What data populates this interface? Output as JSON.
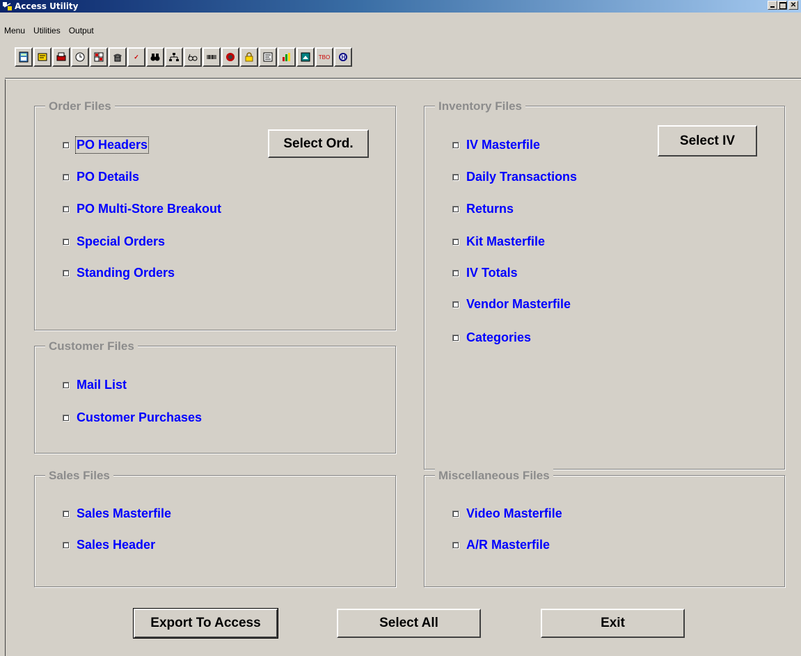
{
  "window": {
    "title": "Access Utility"
  },
  "menu": [
    {
      "label": "Menu"
    },
    {
      "label": "Utilities"
    },
    {
      "label": "Output"
    }
  ],
  "toolbar": {
    "icons": [
      "calculator",
      "note",
      "printer",
      "clock",
      "grid",
      "phone",
      "spell-check",
      "binoculars",
      "tree",
      "glasses",
      "barcode",
      "target",
      "lock",
      "form",
      "chart",
      "image",
      "tbo",
      "help"
    ]
  },
  "order_files": {
    "title": "Order Files",
    "items": [
      "PO Headers",
      "PO Details",
      "PO Multi-Store Breakout",
      "Special Orders",
      "Standing Orders"
    ],
    "select_button": "Select Ord."
  },
  "customer_files": {
    "title": "Customer Files",
    "items": [
      "Mail List",
      "Customer Purchases"
    ]
  },
  "sales_files": {
    "title": "Sales Files",
    "items": [
      "Sales Masterfile",
      "Sales Header"
    ]
  },
  "inventory_files": {
    "title": "Inventory Files",
    "items": [
      "IV Masterfile",
      "Daily Transactions",
      "Returns",
      "Kit Masterfile",
      "IV Totals",
      "Vendor Masterfile",
      "Categories"
    ],
    "select_button": "Select IV"
  },
  "misc_files": {
    "title": "Miscellaneous Files",
    "items": [
      "Video Masterfile",
      "A/R Masterfile"
    ]
  },
  "buttons": {
    "export": "Export To Access",
    "select_all": "Select All",
    "exit": "Exit"
  },
  "colors": {
    "label": "#0000ff",
    "group_title": "#8c8c8c",
    "face": "#d4d0c8"
  }
}
